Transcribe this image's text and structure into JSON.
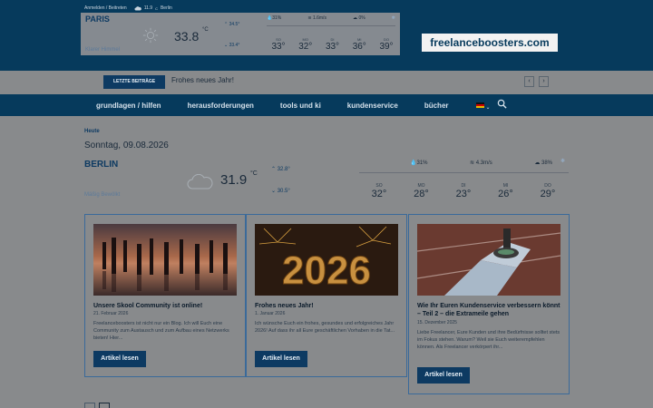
{
  "top": {
    "login": "Anmelden / Beitreten",
    "mini_temp": "11.9",
    "mini_unit": "C",
    "mini_city": "Berlin"
  },
  "weather_widget": {
    "city": "PARIS",
    "desc": "Klarer Himmel",
    "temp": "33.8",
    "unit": "°C",
    "hi": "34.5°",
    "lo": "33.4°",
    "humidity": "31%",
    "wind": "1.6m/s",
    "cloud": "0%",
    "days": [
      {
        "name": "SO",
        "temp": "33°"
      },
      {
        "name": "MO",
        "temp": "32°"
      },
      {
        "name": "DI",
        "temp": "33°"
      },
      {
        "name": "MI",
        "temp": "36°"
      },
      {
        "name": "DO",
        "temp": "39°"
      }
    ]
  },
  "brand": "freelanceboosters.com",
  "ticker": {
    "label": "LETZTE BEITRÄGE",
    "text": "Frohes neues Jahr!",
    "prev": "‹",
    "next": "›"
  },
  "nav": {
    "items": [
      "grundlagen / hilfen",
      "herausforderungen",
      "tools und ki",
      "kundenservice",
      "bücher"
    ],
    "lang_chevron": "⌄"
  },
  "today": {
    "label": "Heute",
    "date": "Sonntag, 09.08.2026"
  },
  "berlin_weather": {
    "city": "BERLIN",
    "desc": "Mäßig Bewölkt",
    "temp": "31.9",
    "unit": "°C",
    "hi": "32.8°",
    "lo": "30.5°",
    "humidity": "31%",
    "wind": "4.3m/s",
    "cloud": "38%",
    "days": [
      {
        "name": "SO",
        "temp": "32°"
      },
      {
        "name": "MO",
        "temp": "28°"
      },
      {
        "name": "DI",
        "temp": "23°"
      },
      {
        "name": "MI",
        "temp": "26°"
      },
      {
        "name": "DO",
        "temp": "29°"
      }
    ]
  },
  "cards": [
    {
      "title": "Unsere Skool Community ist online!",
      "date": "21. Februar 2026",
      "text": "Freelanceboosters ist nicht nur ein Blog. Ich will Euch eine Community zum Austausch und zum Aufbau eines Netzwerks bieten! Hier...",
      "button": "Artikel lesen"
    },
    {
      "title": "Frohes neues Jahr!",
      "date": "1. Januar 2026",
      "text": "Ich wünsche Euch ein frohes, gesundes und erfolgreiches Jahr 2026! Auf dass ihr all Eure geschäftlichen Vorhaben in die Tat...",
      "button": "Artikel lesen",
      "image_text": "2026"
    },
    {
      "title": "Wie Ihr Euren Kundenservice verbessern könnt – Teil 2 – die Extrameile gehen",
      "date": "15. Dezember 2025",
      "text": "Liebe Freelancer, Eure Kunden und ihre Bedürfnisse solltet stets im Fokus stehen. Warum? Weil sie Euch weiterempfehlen können. Als Freelancer verkörpert ihr...",
      "button": "Artikel lesen"
    }
  ],
  "colors": {
    "primary": "#063a5c",
    "accent": "#0d3a62",
    "background": "#888a8c"
  }
}
